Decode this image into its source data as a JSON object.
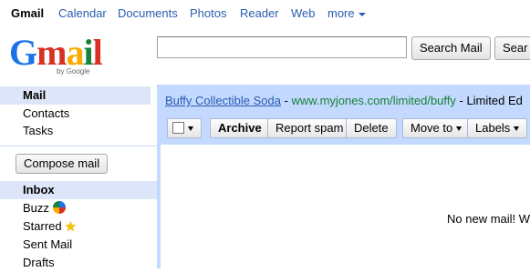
{
  "topbar": {
    "gmail": "Gmail",
    "calendar": "Calendar",
    "documents": "Documents",
    "photos": "Photos",
    "reader": "Reader",
    "web": "Web",
    "more": "more"
  },
  "logo": {
    "text": "Gmail",
    "by": "by Google"
  },
  "search": {
    "value": "",
    "search_mail_label": "Search Mail",
    "search_web_label": "Sear"
  },
  "nav": {
    "mail": "Mail",
    "contacts": "Contacts",
    "tasks": "Tasks",
    "compose": "Compose mail",
    "inbox": "Inbox",
    "buzz": "Buzz",
    "starred": "Starred",
    "sent": "Sent Mail",
    "drafts": "Drafts"
  },
  "promo": {
    "title": "Buffy Collectible Soda",
    "separator": " - ",
    "url": "www.myjones.com/limited/buffy",
    "tail": " - Limited Ed"
  },
  "toolbar": {
    "archive": "Archive",
    "report_spam": "Report spam",
    "delete": "Delete",
    "move_to": "Move to",
    "labels": "Labels"
  },
  "main": {
    "empty_message": "No new mail! W"
  },
  "colors": {
    "link": "#2a5db0",
    "selected_nav": "#dde6f8",
    "panel": "#c3d9ff",
    "url_green": "#188038"
  },
  "icons": {
    "buzz": "buzz-icon",
    "starred": "star-icon",
    "more": "chevron-down-icon"
  }
}
